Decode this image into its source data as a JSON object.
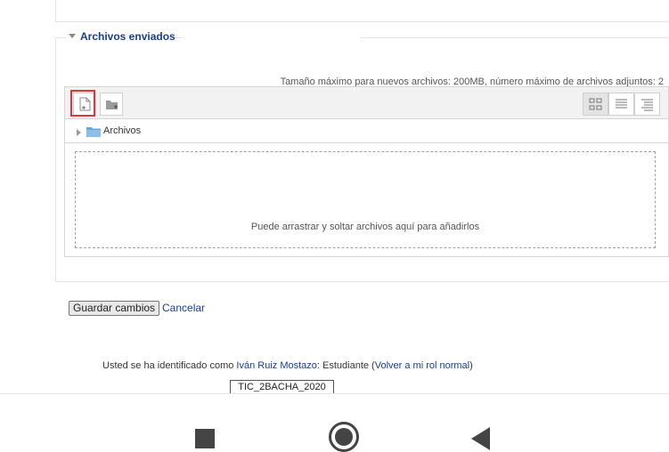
{
  "fieldset": {
    "legend": "Archivos enviados",
    "toggle_icon": "triangle-down-icon"
  },
  "filemanager": {
    "max_size_text": "Tamaño máximo para nuevos archivos: 200MB, número máximo de archivos adjuntos: 2",
    "toolbar": {
      "add_file_icon": "add-file-icon",
      "create_folder_icon": "create-folder-icon",
      "views": [
        "icons-view-icon",
        "list-view-icon",
        "tree-view-icon"
      ]
    },
    "path": {
      "folder_label": "Archivos"
    },
    "dropzone_text": "Puede arrastrar y soltar archivos aquí para añadirlos",
    "highlight_color": "#d9363e"
  },
  "form_buttons": {
    "save_label": "Guardar cambios",
    "cancel_label": "Cancelar"
  },
  "footer": {
    "login_prefix": "Usted se ha identificado como ",
    "user_name": "Iván Ruiz Mostazo",
    "role_sep": ": Estudiante (",
    "return_role": "Volver a mi rol normal",
    "role_suffix": ")",
    "course_button": "TIC_2BACHA_2020"
  },
  "android_nav": {
    "recents_icon": "square-icon",
    "home_icon": "circle-icon",
    "back_icon": "back-triangle-icon"
  },
  "colors": {
    "link": "#1a3c8c",
    "toolbar_bg": "#f2f2f2"
  }
}
